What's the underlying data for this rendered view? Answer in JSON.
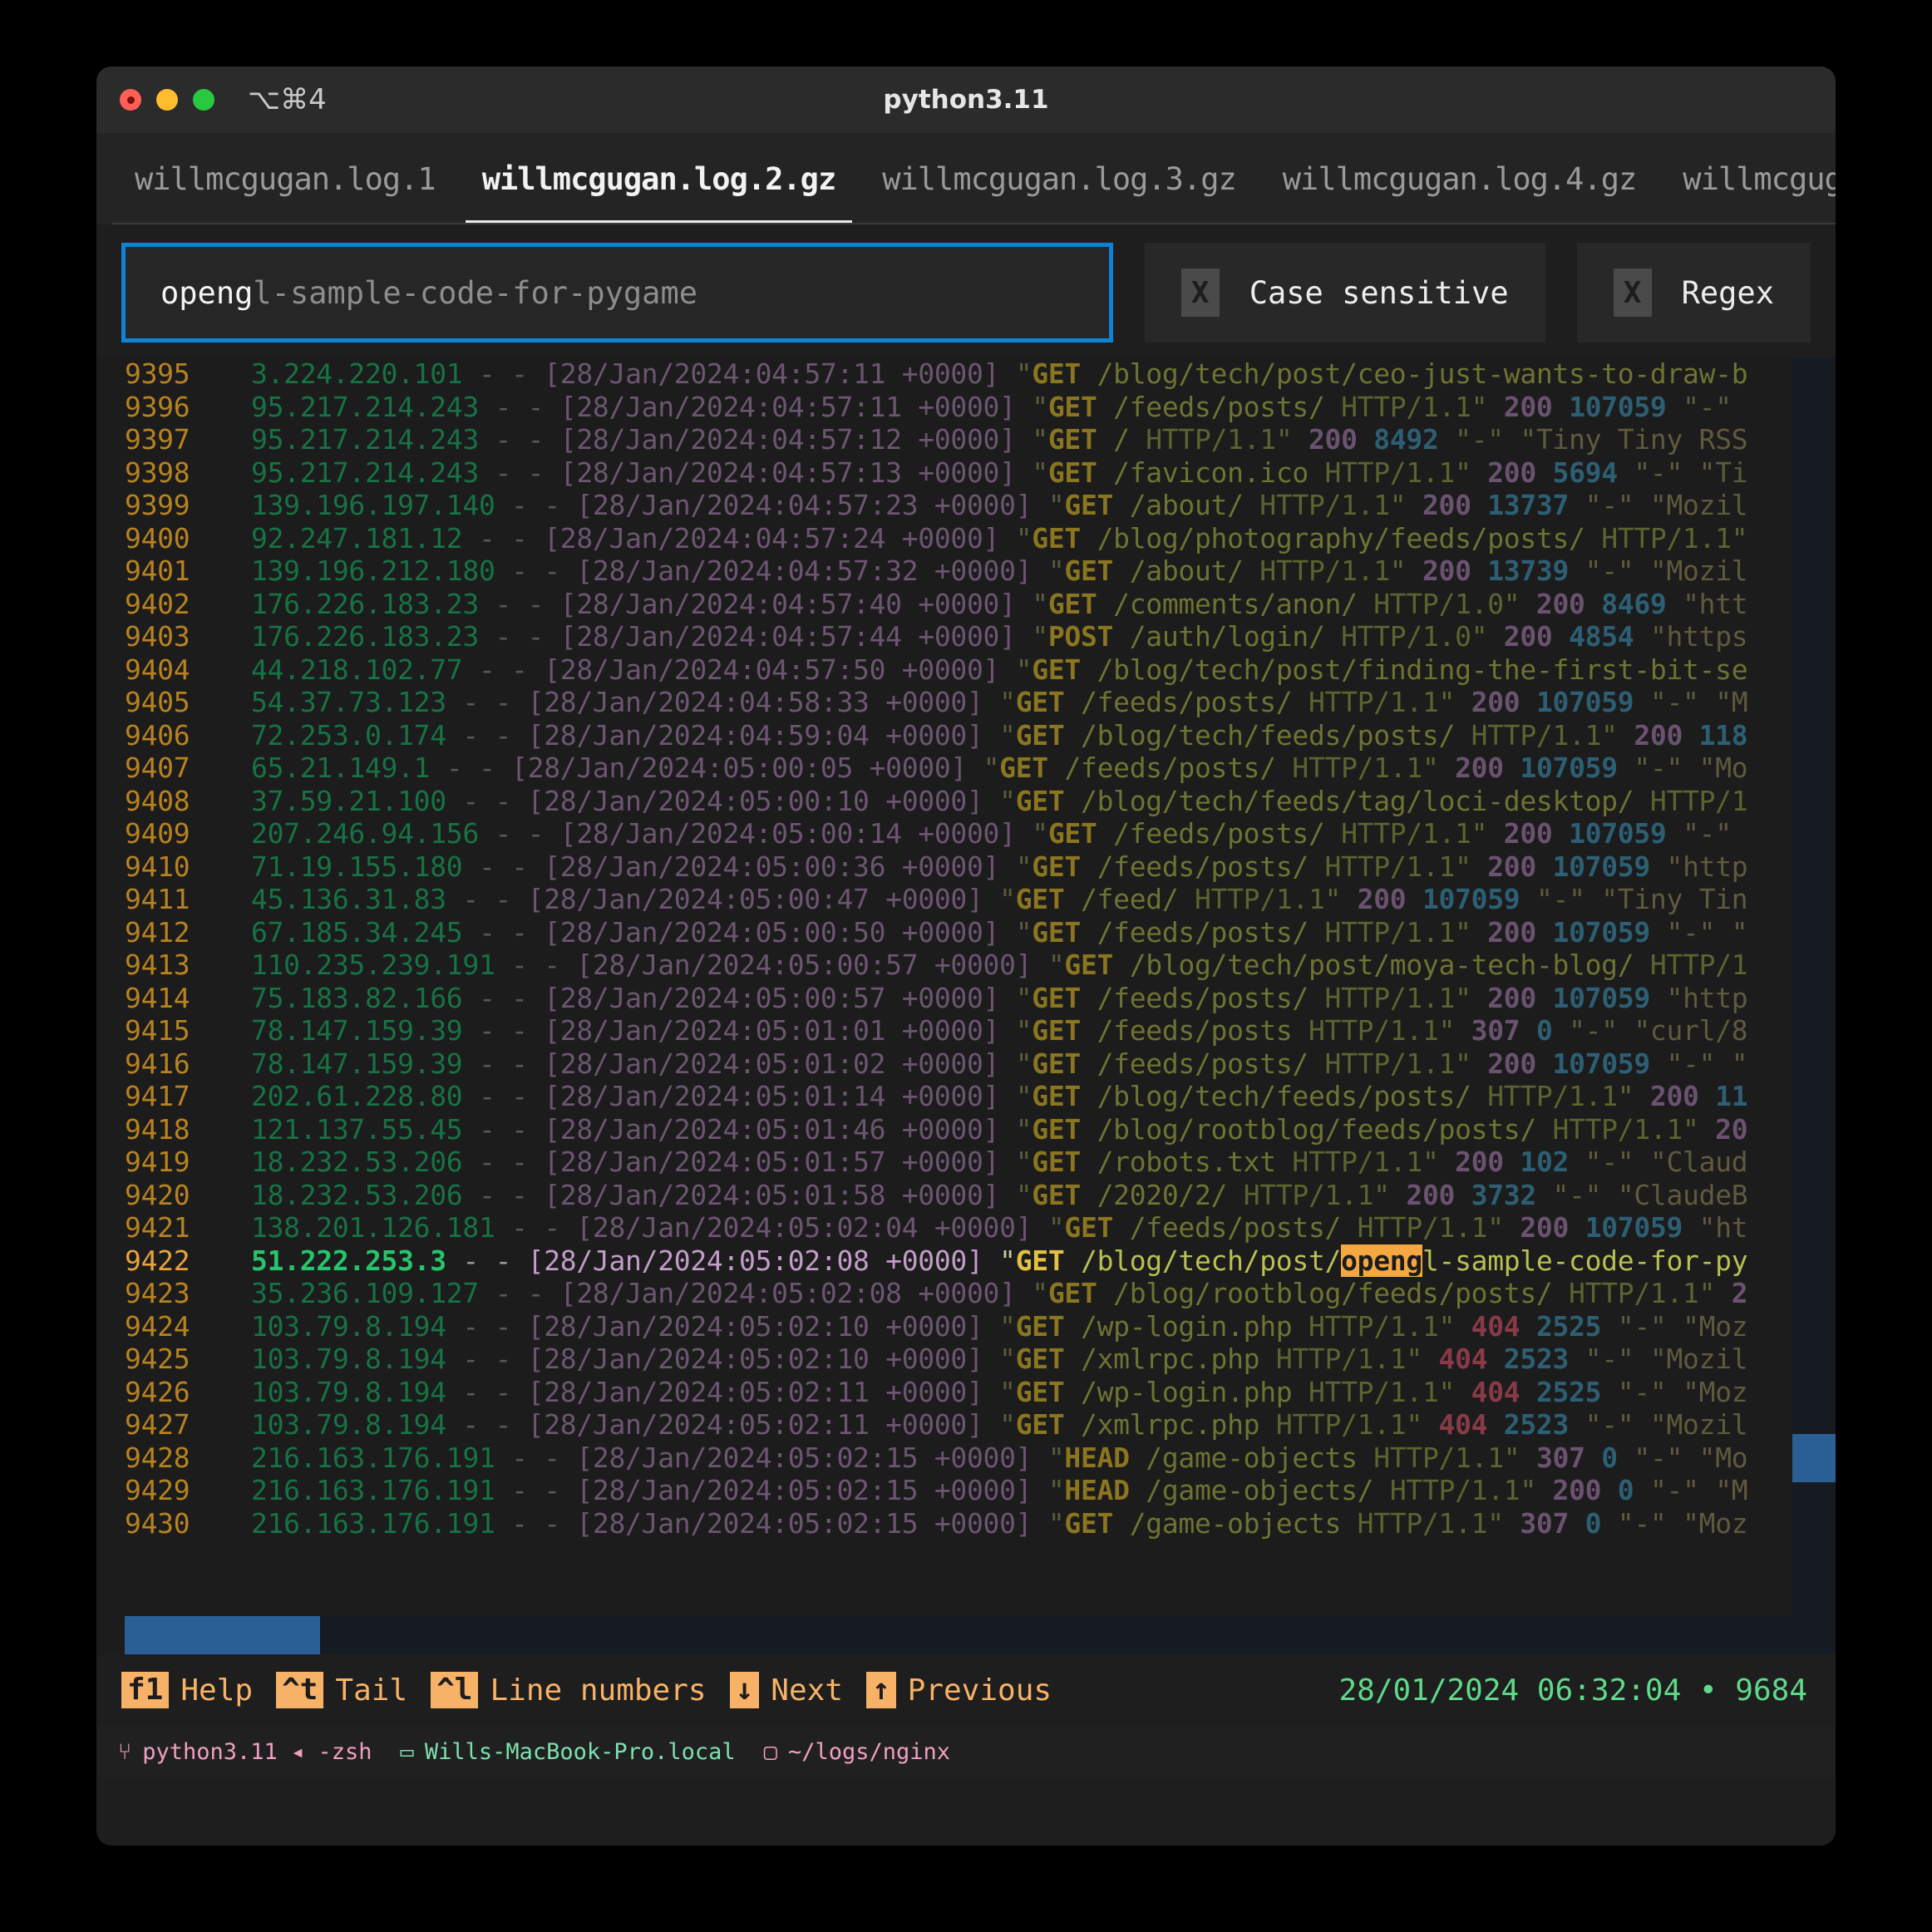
{
  "window": {
    "title": "python3.11",
    "shortcut": "⌥⌘4",
    "traffic": {
      "close": "close-button",
      "minimize": "minimize-button",
      "zoom": "zoom-button"
    }
  },
  "tabs": [
    {
      "label": "willmcgugan.log.1",
      "active": false
    },
    {
      "label": "willmcgugan.log.2.gz",
      "active": true
    },
    {
      "label": "willmcgugan.log.3.gz",
      "active": false
    },
    {
      "label": "willmcgugan.log.4.gz",
      "active": false
    },
    {
      "label": "willmcgugan.l",
      "active": false
    }
  ],
  "search": {
    "typed": "openg",
    "suggestion": "l-sample-code-for-pygame",
    "case_sensitive": {
      "label": "Case sensitive",
      "mark": "X",
      "checked": false
    },
    "regex": {
      "label": "Regex",
      "mark": "X",
      "checked": false
    }
  },
  "log": {
    "lines": [
      {
        "n": "9395",
        "ip": "3.224.220.101",
        "ts": "[28/Jan/2024:04:57:11 +0000]",
        "method": "GET",
        "path": "/blog/tech/post/ceo-just-wants-to-draw-b",
        "proto": "",
        "status": "",
        "size": "",
        "rest": "",
        "sel": false
      },
      {
        "n": "9396",
        "ip": "95.217.214.243",
        "ts": "[28/Jan/2024:04:57:11 +0000]",
        "method": "GET",
        "path": "/feeds/posts/",
        "proto": "HTTP/1.1\"",
        "status": "200",
        "size": "107059",
        "rest": "\"-\"",
        "sel": false
      },
      {
        "n": "9397",
        "ip": "95.217.214.243",
        "ts": "[28/Jan/2024:04:57:12 +0000]",
        "method": "GET",
        "path": "/",
        "proto": "HTTP/1.1\"",
        "status": "200",
        "size": "8492",
        "rest": "\"-\" \"Tiny Tiny RSS",
        "sel": false
      },
      {
        "n": "9398",
        "ip": "95.217.214.243",
        "ts": "[28/Jan/2024:04:57:13 +0000]",
        "method": "GET",
        "path": "/favicon.ico",
        "proto": "HTTP/1.1\"",
        "status": "200",
        "size": "5694",
        "rest": "\"-\" \"Ti",
        "sel": false
      },
      {
        "n": "9399",
        "ip": "139.196.197.140",
        "ts": "[28/Jan/2024:04:57:23 +0000]",
        "method": "GET",
        "path": "/about/",
        "proto": "HTTP/1.1\"",
        "status": "200",
        "size": "13737",
        "rest": "\"-\" \"Mozil",
        "sel": false
      },
      {
        "n": "9400",
        "ip": "92.247.181.12",
        "ts": "[28/Jan/2024:04:57:24 +0000]",
        "method": "GET",
        "path": "/blog/photography/feeds/posts/",
        "proto": "HTTP/1.1\"",
        "status": "",
        "size": "",
        "rest": "",
        "sel": false
      },
      {
        "n": "9401",
        "ip": "139.196.212.180",
        "ts": "[28/Jan/2024:04:57:32 +0000]",
        "method": "GET",
        "path": "/about/",
        "proto": "HTTP/1.1\"",
        "status": "200",
        "size": "13739",
        "rest": "\"-\" \"Mozil",
        "sel": false
      },
      {
        "n": "9402",
        "ip": "176.226.183.23",
        "ts": "[28/Jan/2024:04:57:40 +0000]",
        "method": "GET",
        "path": "/comments/anon/",
        "proto": "HTTP/1.0\"",
        "status": "200",
        "size": "8469",
        "rest": "\"htt",
        "sel": false
      },
      {
        "n": "9403",
        "ip": "176.226.183.23",
        "ts": "[28/Jan/2024:04:57:44 +0000]",
        "method": "POST",
        "path": "/auth/login/",
        "proto": "HTTP/1.0\"",
        "status": "200",
        "size": "4854",
        "rest": "\"https",
        "sel": false
      },
      {
        "n": "9404",
        "ip": "44.218.102.77",
        "ts": "[28/Jan/2024:04:57:50 +0000]",
        "method": "GET",
        "path": "/blog/tech/post/finding-the-first-bit-se",
        "proto": "",
        "status": "",
        "size": "",
        "rest": "",
        "sel": false
      },
      {
        "n": "9405",
        "ip": "54.37.73.123",
        "ts": "[28/Jan/2024:04:58:33 +0000]",
        "method": "GET",
        "path": "/feeds/posts/",
        "proto": "HTTP/1.1\"",
        "status": "200",
        "size": "107059",
        "rest": "\"-\" \"M",
        "sel": false
      },
      {
        "n": "9406",
        "ip": "72.253.0.174",
        "ts": "[28/Jan/2024:04:59:04 +0000]",
        "method": "GET",
        "path": "/blog/tech/feeds/posts/",
        "proto": "HTTP/1.1\"",
        "status": "200",
        "size": "118",
        "rest": "",
        "sel": false
      },
      {
        "n": "9407",
        "ip": "65.21.149.1",
        "ts": "[28/Jan/2024:05:00:05 +0000]",
        "method": "GET",
        "path": "/feeds/posts/",
        "proto": "HTTP/1.1\"",
        "status": "200",
        "size": "107059",
        "rest": "\"-\" \"Mo",
        "sel": false
      },
      {
        "n": "9408",
        "ip": "37.59.21.100",
        "ts": "[28/Jan/2024:05:00:10 +0000]",
        "method": "GET",
        "path": "/blog/tech/feeds/tag/loci-desktop/",
        "proto": "HTTP/1",
        "status": "",
        "size": "",
        "rest": "",
        "sel": false
      },
      {
        "n": "9409",
        "ip": "207.246.94.156",
        "ts": "[28/Jan/2024:05:00:14 +0000]",
        "method": "GET",
        "path": "/feeds/posts/",
        "proto": "HTTP/1.1\"",
        "status": "200",
        "size": "107059",
        "rest": "\"-\"",
        "sel": false
      },
      {
        "n": "9410",
        "ip": "71.19.155.180",
        "ts": "[28/Jan/2024:05:00:36 +0000]",
        "method": "GET",
        "path": "/feeds/posts/",
        "proto": "HTTP/1.1\"",
        "status": "200",
        "size": "107059",
        "rest": "\"http",
        "sel": false
      },
      {
        "n": "9411",
        "ip": "45.136.31.83",
        "ts": "[28/Jan/2024:05:00:47 +0000]",
        "method": "GET",
        "path": "/feed/",
        "proto": "HTTP/1.1\"",
        "status": "200",
        "size": "107059",
        "rest": "\"-\" \"Tiny Tin",
        "sel": false
      },
      {
        "n": "9412",
        "ip": "67.185.34.245",
        "ts": "[28/Jan/2024:05:00:50 +0000]",
        "method": "GET",
        "path": "/feeds/posts/",
        "proto": "HTTP/1.1\"",
        "status": "200",
        "size": "107059",
        "rest": "\"-\" \"",
        "sel": false
      },
      {
        "n": "9413",
        "ip": "110.235.239.191",
        "ts": "[28/Jan/2024:05:00:57 +0000]",
        "method": "GET",
        "path": "/blog/tech/post/moya-tech-blog/",
        "proto": "HTTP/1",
        "status": "",
        "size": "",
        "rest": "",
        "sel": false
      },
      {
        "n": "9414",
        "ip": "75.183.82.166",
        "ts": "[28/Jan/2024:05:00:57 +0000]",
        "method": "GET",
        "path": "/feeds/posts/",
        "proto": "HTTP/1.1\"",
        "status": "200",
        "size": "107059",
        "rest": "\"http",
        "sel": false
      },
      {
        "n": "9415",
        "ip": "78.147.159.39",
        "ts": "[28/Jan/2024:05:01:01 +0000]",
        "method": "GET",
        "path": "/feeds/posts",
        "proto": "HTTP/1.1\"",
        "status": "307",
        "size": "0",
        "rest": "\"-\" \"curl/8",
        "sel": false
      },
      {
        "n": "9416",
        "ip": "78.147.159.39",
        "ts": "[28/Jan/2024:05:01:02 +0000]",
        "method": "GET",
        "path": "/feeds/posts/",
        "proto": "HTTP/1.1\"",
        "status": "200",
        "size": "107059",
        "rest": "\"-\" \"",
        "sel": false
      },
      {
        "n": "9417",
        "ip": "202.61.228.80",
        "ts": "[28/Jan/2024:05:01:14 +0000]",
        "method": "GET",
        "path": "/blog/tech/feeds/posts/",
        "proto": "HTTP/1.1\"",
        "status": "200",
        "size": "11",
        "rest": "",
        "sel": false
      },
      {
        "n": "9418",
        "ip": "121.137.55.45",
        "ts": "[28/Jan/2024:05:01:46 +0000]",
        "method": "GET",
        "path": "/blog/rootblog/feeds/posts/",
        "proto": "HTTP/1.1\"",
        "status": "20",
        "size": "",
        "rest": "",
        "sel": false
      },
      {
        "n": "9419",
        "ip": "18.232.53.206",
        "ts": "[28/Jan/2024:05:01:57 +0000]",
        "method": "GET",
        "path": "/robots.txt",
        "proto": "HTTP/1.1\"",
        "status": "200",
        "size": "102",
        "rest": "\"-\" \"Claud",
        "sel": false
      },
      {
        "n": "9420",
        "ip": "18.232.53.206",
        "ts": "[28/Jan/2024:05:01:58 +0000]",
        "method": "GET",
        "path": "/2020/2/",
        "proto": "HTTP/1.1\"",
        "status": "200",
        "size": "3732",
        "rest": "\"-\" \"ClaudeB",
        "sel": false
      },
      {
        "n": "9421",
        "ip": "138.201.126.181",
        "ts": "[28/Jan/2024:05:02:04 +0000]",
        "method": "GET",
        "path": "/feeds/posts/",
        "proto": "HTTP/1.1\"",
        "status": "200",
        "size": "107059",
        "rest": "\"ht",
        "sel": false
      },
      {
        "n": "9422",
        "ip": "51.222.253.3",
        "ts": "[28/Jan/2024:05:02:08 +0000]",
        "method": "GET",
        "path_pre": "/blog/tech/post/",
        "path_hit": "openg",
        "path_post": "l-sample-code-for-py",
        "proto": "",
        "status": "",
        "size": "",
        "rest": "",
        "sel": true
      },
      {
        "n": "9423",
        "ip": "35.236.109.127",
        "ts": "[28/Jan/2024:05:02:08 +0000]",
        "method": "GET",
        "path": "/blog/rootblog/feeds/posts/",
        "proto": "HTTP/1.1\"",
        "status": "2",
        "size": "",
        "rest": "",
        "sel": false
      },
      {
        "n": "9424",
        "ip": "103.79.8.194",
        "ts": "[28/Jan/2024:05:02:10 +0000]",
        "method": "GET",
        "path": "/wp-login.php",
        "proto": "HTTP/1.1\"",
        "status": "404",
        "size": "2525",
        "rest": "\"-\" \"Moz",
        "sel": false
      },
      {
        "n": "9425",
        "ip": "103.79.8.194",
        "ts": "[28/Jan/2024:05:02:10 +0000]",
        "method": "GET",
        "path": "/xmlrpc.php",
        "proto": "HTTP/1.1\"",
        "status": "404",
        "size": "2523",
        "rest": "\"-\" \"Mozil",
        "sel": false
      },
      {
        "n": "9426",
        "ip": "103.79.8.194",
        "ts": "[28/Jan/2024:05:02:11 +0000]",
        "method": "GET",
        "path": "/wp-login.php",
        "proto": "HTTP/1.1\"",
        "status": "404",
        "size": "2525",
        "rest": "\"-\" \"Moz",
        "sel": false
      },
      {
        "n": "9427",
        "ip": "103.79.8.194",
        "ts": "[28/Jan/2024:05:02:11 +0000]",
        "method": "GET",
        "path": "/xmlrpc.php",
        "proto": "HTTP/1.1\"",
        "status": "404",
        "size": "2523",
        "rest": "\"-\" \"Mozil",
        "sel": false
      },
      {
        "n": "9428",
        "ip": "216.163.176.191",
        "ts": "[28/Jan/2024:05:02:15 +0000]",
        "method": "HEAD",
        "path": "/game-objects",
        "proto": "HTTP/1.1\"",
        "status": "307",
        "size": "0",
        "rest": "\"-\" \"Mo",
        "sel": false
      },
      {
        "n": "9429",
        "ip": "216.163.176.191",
        "ts": "[28/Jan/2024:05:02:15 +0000]",
        "method": "HEAD",
        "path": "/game-objects/",
        "proto": "HTTP/1.1\"",
        "status": "200",
        "size": "0",
        "rest": "\"-\" \"M",
        "sel": false
      },
      {
        "n": "9430",
        "ip": "216.163.176.191",
        "ts": "[28/Jan/2024:05:02:15 +0000]",
        "method": "GET",
        "path": "/game-objects",
        "proto": "HTTP/1.1\"",
        "status": "307",
        "size": "0",
        "rest": "\"-\" \"Moz",
        "sel": false
      }
    ]
  },
  "keybar": {
    "keys": [
      {
        "badge": "f1",
        "label": "Help"
      },
      {
        "badge": "^t",
        "label": "Tail"
      },
      {
        "badge": "^l",
        "label": "Line numbers"
      },
      {
        "badge": "↓",
        "label": "Next"
      },
      {
        "badge": "↑",
        "label": "Previous"
      }
    ],
    "clock": "28/01/2024 06:32:04 • 9684"
  },
  "statusbar": {
    "shell": "python3.11 ◂ -zsh",
    "host": "Wills-MacBook-Pro.local",
    "path": "~/logs/nginx",
    "shell_icon": "⑂",
    "host_icon": "▭",
    "path_icon": "▢"
  }
}
